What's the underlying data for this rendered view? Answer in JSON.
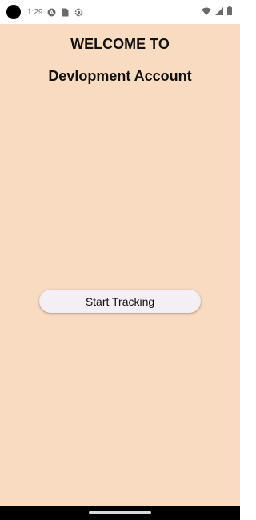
{
  "status_bar": {
    "time": "1:29",
    "left_icons": [
      "a-icon",
      "sim-card-icon",
      "settings-gear-icon"
    ],
    "right_icons": [
      "wifi-icon",
      "signal-icon",
      "battery-icon"
    ]
  },
  "header": {
    "welcome": "WELCOME TO",
    "account": "Devlopment Account"
  },
  "main": {
    "start_button_label": "Start Tracking"
  },
  "colors": {
    "background": "#f9dbc2",
    "button": "#f4eff5",
    "text": "#111111"
  }
}
